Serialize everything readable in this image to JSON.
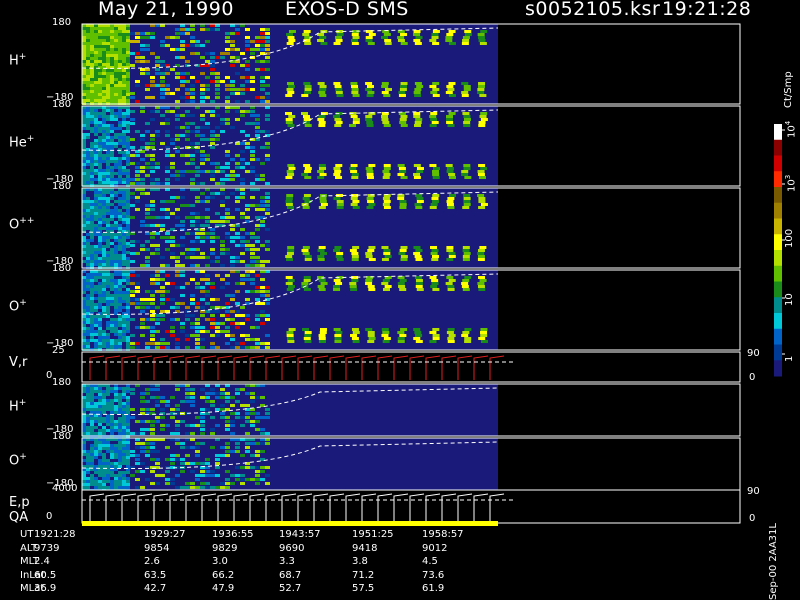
{
  "header": {
    "date": "May 21, 1990",
    "instrument": "EXOS-D SMS",
    "file": "s0052105.ksr",
    "time": "19:21:28"
  },
  "chart_data": {
    "type": "heatmap",
    "panels": [
      {
        "label": "H",
        "sup": "+",
        "ymax": "180",
        "ymin": "−180"
      },
      {
        "label": "He",
        "sup": "+",
        "ymax": "180",
        "ymin": "−180"
      },
      {
        "label": "O",
        "sup": "++",
        "ymax": "180",
        "ymin": "−180"
      },
      {
        "label": "O",
        "sup": "+",
        "ymax": "180",
        "ymin": "−180"
      },
      {
        "label": "V,r",
        "sup": "",
        "ymax": "25",
        "ymin": "0",
        "right_top": "90",
        "right_bottom": "0"
      },
      {
        "label": "H",
        "sup": "+",
        "ymax": "180",
        "ymin": "−180"
      },
      {
        "label": "O",
        "sup": "+",
        "ymax": "180",
        "ymin": "−180"
      },
      {
        "label": "E,p",
        "sup": "",
        "ymax": "4000",
        "ymin": "0",
        "right_top": "90",
        "right_bottom": "0"
      }
    ],
    "qa_label": "QA",
    "colorbar": {
      "title": "Ct/Smp",
      "ticks": [
        {
          "text": "10",
          "sup": "4"
        },
        {
          "text": "10",
          "sup": "3"
        },
        {
          "text": "100",
          "sup": ""
        },
        {
          "text": "10",
          "sup": ""
        },
        {
          "text": "1",
          "sup": ""
        }
      ],
      "colors": [
        "#ffffff",
        "#8b0000",
        "#d00000",
        "#ff2a00",
        "#7a5a00",
        "#a08000",
        "#c9b400",
        "#ffff00",
        "#b4e000",
        "#60c000",
        "#1a8c1a",
        "#008c8c",
        "#00c8d8",
        "#0064c8",
        "#003c96",
        "#1a1a7a"
      ]
    },
    "footer_code": "Sep-00 2AA31L",
    "table": {
      "rows": [
        {
          "label": "UT",
          "values": [
            "1921:28",
            "1929:27",
            "1936:55",
            "1943:57",
            "1951:25",
            "1958:57"
          ]
        },
        {
          "label": "ALT",
          "values": [
            "9739",
            "9854",
            "9829",
            "9690",
            "9418",
            "9012"
          ]
        },
        {
          "label": "MLT",
          "values": [
            "2.4",
            "2.6",
            "3.0",
            "3.3",
            "3.8",
            "4.5"
          ]
        },
        {
          "label": "InLat",
          "values": [
            "60.5",
            "63.5",
            "66.2",
            "68.7",
            "71.2",
            "73.6"
          ]
        },
        {
          "label": "MLat",
          "values": [
            "36.9",
            "42.7",
            "47.9",
            "52.7",
            "57.5",
            "61.9"
          ]
        }
      ]
    }
  }
}
